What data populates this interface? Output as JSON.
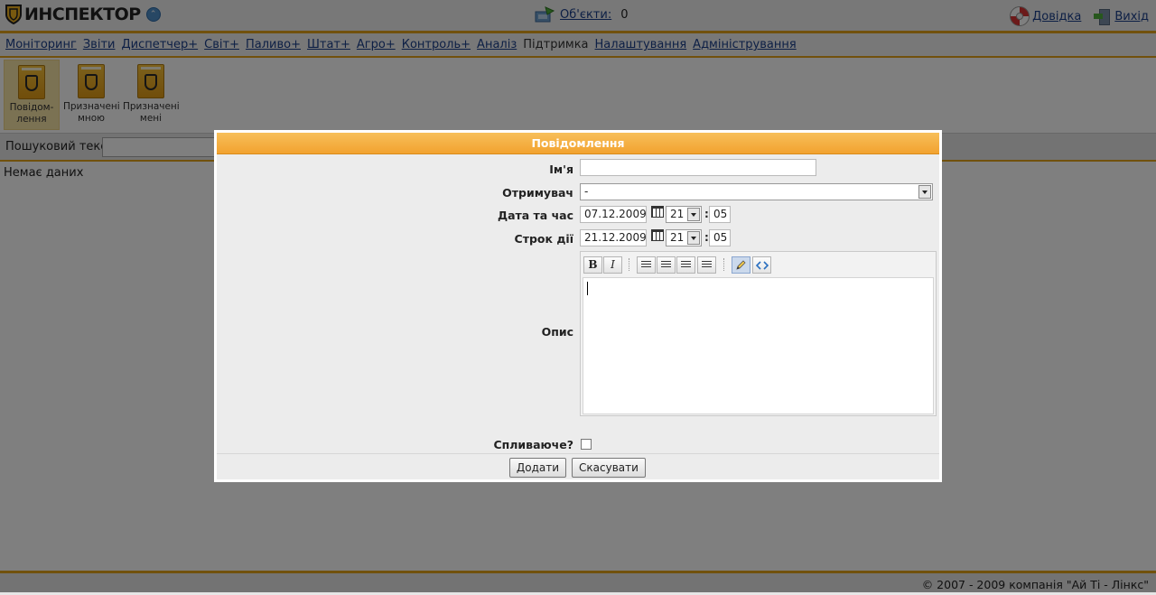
{
  "header": {
    "logo_text": "ИНСПЕКТОР",
    "objects_label": "Об'єкти:",
    "objects_count": "0",
    "help_label": "Довідка",
    "exit_label": "Вихід"
  },
  "nav": {
    "items": [
      "Моніторинг",
      "Звіти",
      "Диспетчер+",
      "Світ+",
      "Паливо+",
      "Штат+",
      "Агро+",
      "Контроль+",
      "Аналіз",
      "Підтримка",
      "Налаштування",
      "Адміністрування"
    ],
    "active_index": 9
  },
  "toolbar": {
    "items": [
      {
        "label_line1": "Повідом-",
        "label_line2": "лення"
      },
      {
        "label_line1": "Призначені",
        "label_line2": "мною"
      },
      {
        "label_line1": "Призначені",
        "label_line2": "мені"
      }
    ]
  },
  "search": {
    "label": "Пошуковий текст:",
    "value": ""
  },
  "content": {
    "no_data": "Немає даних"
  },
  "footer": {
    "copyright": "© 2007 - 2009 компанія \"Ай Ті - Лінкс\""
  },
  "dialog": {
    "title": "Повідомлення",
    "name_label": "Ім'я",
    "name_value": "",
    "recipient_label": "Отримувач",
    "recipient_value": "-",
    "datetime_label": "Дата та час",
    "date_value": "07.12.2009",
    "hour_value": "21",
    "minute_value": "05",
    "expiry_label": "Строк дії",
    "expiry_date": "21.12.2009",
    "expiry_hour": "21",
    "expiry_minute": "05",
    "desc_label": "Опис",
    "editor_buttons": {
      "bold": "B",
      "italic": "I"
    },
    "popup_label": "Спливаюче?",
    "popup_checked": false,
    "add_button": "Додати",
    "cancel_button": "Скасувати"
  }
}
